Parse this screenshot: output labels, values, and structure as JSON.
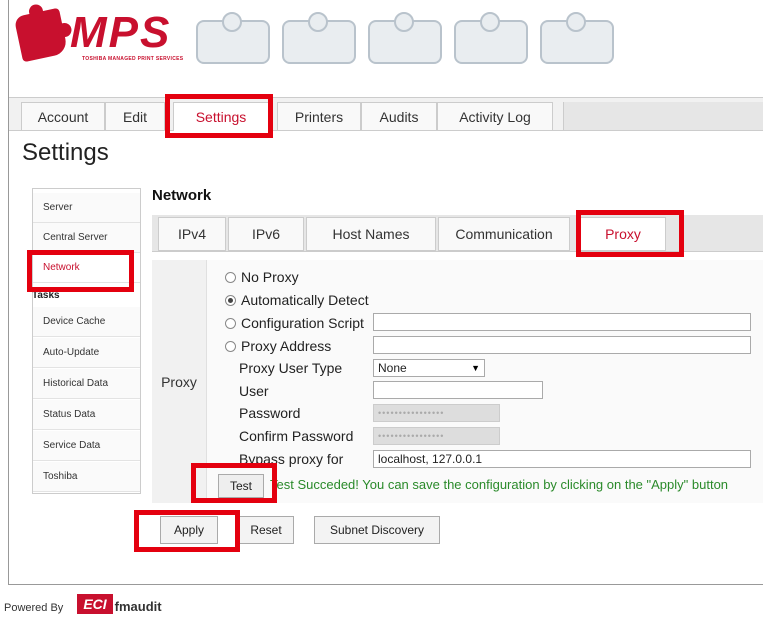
{
  "header": {
    "logo_text": "MPS",
    "logo_subtitle": "TOSHIBA MANAGED PRINT SERVICES"
  },
  "main_tabs": [
    {
      "label": "Account"
    },
    {
      "label": "Edit"
    },
    {
      "label": "Settings"
    },
    {
      "label": "Printers"
    },
    {
      "label": "Audits"
    },
    {
      "label": "Activity Log"
    }
  ],
  "page_title": "Settings",
  "sidebar": {
    "items": [
      {
        "label": "Server"
      },
      {
        "label": "Central Server"
      },
      {
        "label": "Network"
      }
    ],
    "tasks_heading": "Tasks",
    "task_items": [
      {
        "label": "Device Cache"
      },
      {
        "label": "Auto-Update"
      },
      {
        "label": "Historical Data"
      },
      {
        "label": "Status Data"
      },
      {
        "label": "Service Data"
      },
      {
        "label": "Toshiba"
      }
    ]
  },
  "section_title": "Network",
  "sub_tabs": [
    {
      "label": "IPv4"
    },
    {
      "label": "IPv6"
    },
    {
      "label": "Host Names"
    },
    {
      "label": "Communication"
    },
    {
      "label": "Proxy"
    }
  ],
  "proxy": {
    "row_label": "Proxy",
    "options": {
      "no_proxy": "No Proxy",
      "auto_detect": "Automatically Detect",
      "config_script": "Configuration Script",
      "proxy_address": "Proxy Address"
    },
    "selected_option": "Automatically Detect",
    "config_script_value": "",
    "proxy_address_value": "",
    "user_type_label": "Proxy User Type",
    "user_type_value": "None",
    "user_label": "User",
    "user_value": "",
    "password_label": "Password",
    "password_value": "••••••••••••••••",
    "confirm_password_label": "Confirm Password",
    "confirm_password_value": "••••••••••••••••",
    "bypass_label": "Bypass proxy for",
    "bypass_value": "localhost, 127.0.0.1",
    "test_button": "Test",
    "test_message": "Test Succeded! You can save the configuration by clicking on the \"Apply\" button"
  },
  "actions": {
    "apply": "Apply",
    "reset": "Reset",
    "subnet_discovery": "Subnet Discovery"
  },
  "footer": {
    "powered_by": "Powered By",
    "brand": "ECI",
    "product": "fmaudit"
  },
  "colors": {
    "accent": "#c8102e",
    "highlight": "#e4000f",
    "success": "#2a8a2a"
  }
}
